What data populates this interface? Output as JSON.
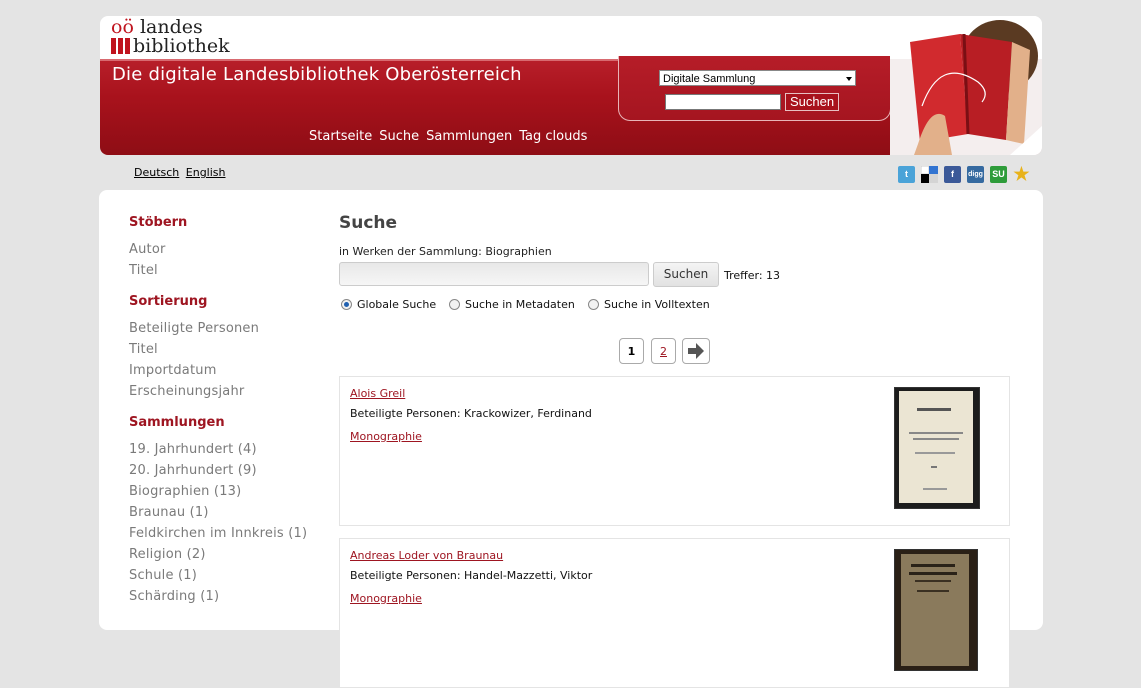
{
  "header": {
    "logo_line1_prefix": "oö",
    "logo_line1": "landes",
    "logo_line2": "bibliothek",
    "site_title": "Die digitale Landesbibliothek Oberösterreich",
    "collection_select": "Digitale Sammlung",
    "search_button": "Suchen",
    "nav": [
      "Startseite",
      "Suche",
      "Sammlungen",
      "Tag clouds"
    ]
  },
  "languages": [
    "Deutsch",
    "English"
  ],
  "social": [
    {
      "name": "twitter-icon",
      "glyph": "t",
      "color": "#4aa3d8"
    },
    {
      "name": "delicious-icon",
      "glyph": "",
      "color": "#3274d1"
    },
    {
      "name": "facebook-icon",
      "glyph": "f",
      "color": "#3b5998"
    },
    {
      "name": "digg-icon",
      "glyph": "digg",
      "color": "#356aa0"
    },
    {
      "name": "stumbleupon-icon",
      "glyph": "SU",
      "color": "#2e9c3a"
    },
    {
      "name": "star-icon",
      "glyph": "★",
      "color": "#e8b21a"
    }
  ],
  "sidebar": {
    "browse_heading": "Stöbern",
    "browse_items": [
      "Autor",
      "Titel"
    ],
    "sort_heading": "Sortierung",
    "sort_items": [
      "Beteiligte Personen",
      "Titel",
      "Importdatum",
      "Erscheinungsjahr"
    ],
    "collections_heading": "Sammlungen",
    "collection_items": [
      "19. Jahrhundert (4)",
      "20. Jahrhundert (9)",
      "Biographien (13)",
      "Braunau (1)",
      "Feldkirchen im Innkreis (1)",
      "Religion (2)",
      "Schule (1)",
      "Schärding (1)"
    ]
  },
  "main": {
    "title": "Suche",
    "in_works": "in Werken der Sammlung: Biographien",
    "search_button": "Suchen",
    "hits": "Treffer: 13",
    "radios": [
      "Globale Suche",
      "Suche in Metadaten",
      "Suche in Volltexten"
    ],
    "selected_radio": 0,
    "pages": [
      "1",
      "2"
    ],
    "current_page": "1",
    "results": [
      {
        "title": "Alois Greil",
        "persons": "Beteiligte Personen: Krackowizer, Ferdinand",
        "type": "Monographie"
      },
      {
        "title": "Andreas Loder von Braunau",
        "persons": "Beteiligte Personen: Handel-Mazzetti, Viktor",
        "type": "Monographie"
      }
    ]
  },
  "colors": {
    "brand_red": "#a8121c",
    "link_red": "#9e1521",
    "background": "#e4e4e4"
  }
}
